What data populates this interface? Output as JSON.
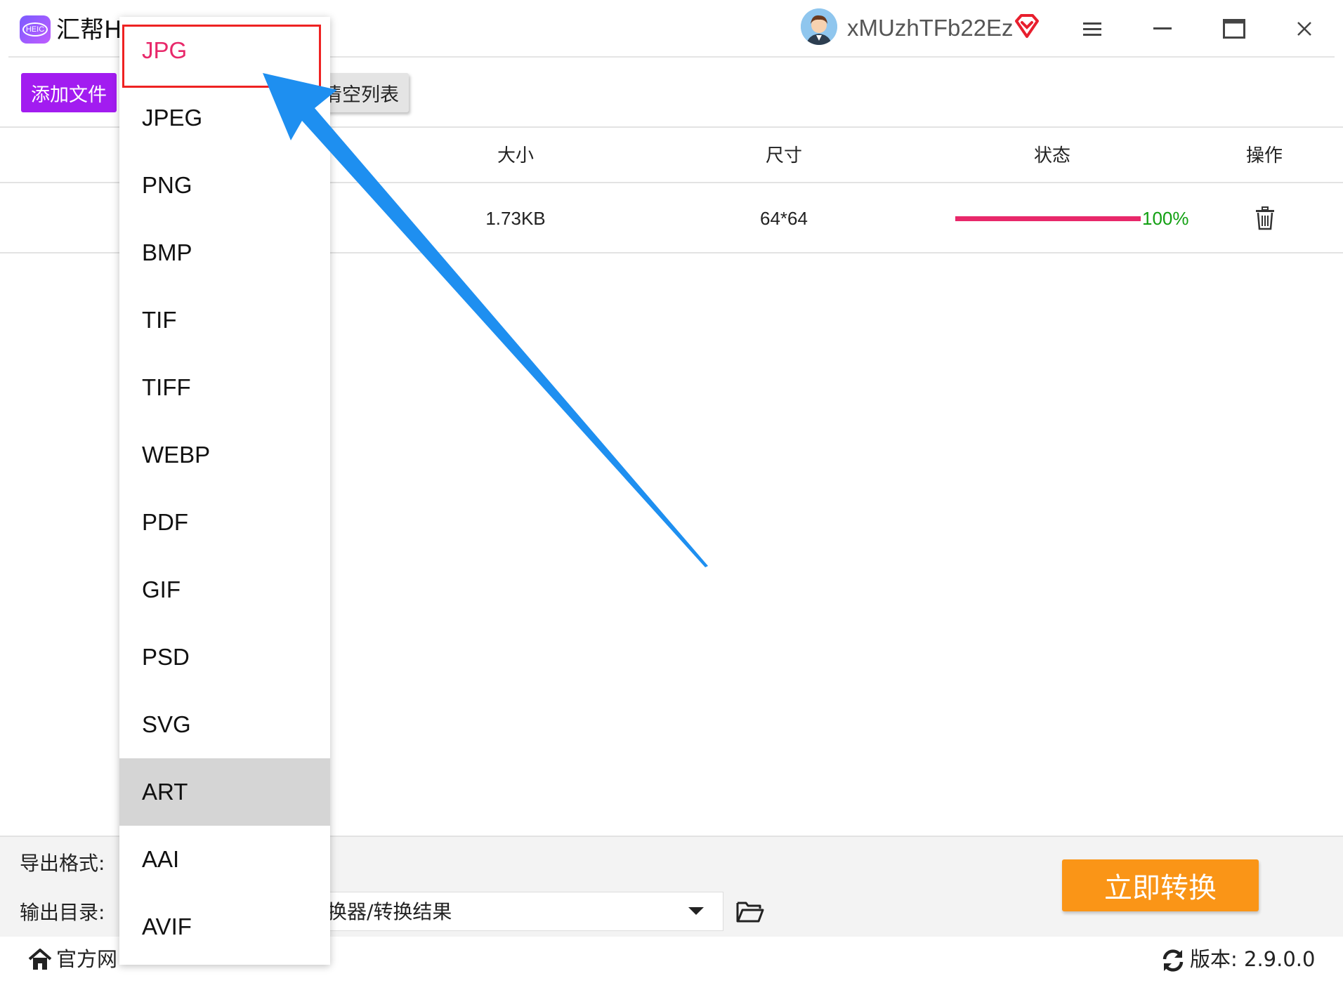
{
  "app": {
    "title": "汇帮HE",
    "logo_text": "HEIC"
  },
  "user": {
    "name": "xMUzhTFb22Ez"
  },
  "window_controls": [
    "menu-icon",
    "minimize-icon",
    "maximize-icon",
    "close-icon"
  ],
  "toolbar": {
    "add_file_label": "添加文件",
    "clear_list_label": "清空列表"
  },
  "table": {
    "columns": [
      "大小",
      "尺寸",
      "状态",
      "操作"
    ],
    "rows": [
      {
        "size": "1.73KB",
        "dimensions": "64*64",
        "progress": 1.0,
        "progress_label": "100%",
        "action_icon": "trash-icon"
      }
    ]
  },
  "bottom": {
    "format_label": "导出格式:",
    "output_label": "输出目录:",
    "output_path": "换器/转换结果",
    "convert_label": "立即转换"
  },
  "statusbar": {
    "home_label": "官方网",
    "version_label": "版本:  2.9.0.0"
  },
  "format_menu": {
    "items": [
      "JPG",
      "JPEG",
      "PNG",
      "BMP",
      "TIF",
      "TIFF",
      "WEBP",
      "PDF",
      "GIF",
      "PSD",
      "SVG",
      "ART",
      "AAI",
      "AVIF"
    ],
    "selected": "JPG",
    "hovered": "ART"
  },
  "colors": {
    "accent_purple": "#a21cf0",
    "convert_orange": "#fa9517",
    "progress_pink": "#e8286a",
    "success_green": "#12a012",
    "annotation_red": "#ee2222",
    "annotation_blue": "#1e8ff0"
  }
}
